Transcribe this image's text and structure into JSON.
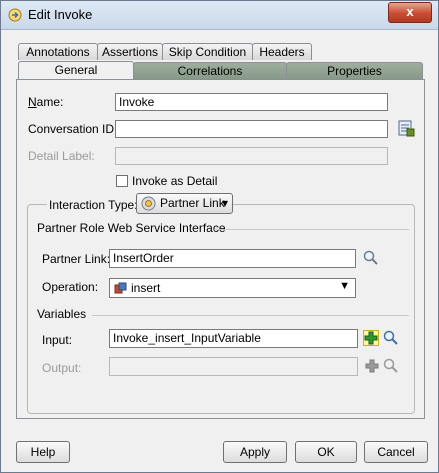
{
  "window": {
    "title": "Edit Invoke",
    "close_label": "x"
  },
  "tabs": {
    "row1": [
      "Annotations",
      "Assertions",
      "Skip Condition",
      "Headers"
    ],
    "row2": [
      "General",
      "Correlations",
      "Properties"
    ],
    "active": "General"
  },
  "general": {
    "name_label": "Name:",
    "name_value": "Invoke",
    "conversation_label": "Conversation ID:",
    "conversation_value": "",
    "detail_label": "Detail Label:",
    "detail_value": "",
    "invoke_detail_label": "Invoke as Detail",
    "invoke_detail_checked": false,
    "interaction_type_label": "Interaction Type:",
    "interaction_type_value": "Partner Link",
    "partner_section": "Partner Role Web Service Interface",
    "partner_link_label": "Partner Link:",
    "partner_link_value": "InsertOrder",
    "operation_label": "Operation:",
    "operation_value": "insert",
    "variables_section": "Variables",
    "input_label": "Input:",
    "input_value": "Invoke_insert_InputVariable",
    "output_label": "Output:",
    "output_value": ""
  },
  "buttons": {
    "help": "Help",
    "apply": "Apply",
    "ok": "OK",
    "cancel": "Cancel"
  }
}
